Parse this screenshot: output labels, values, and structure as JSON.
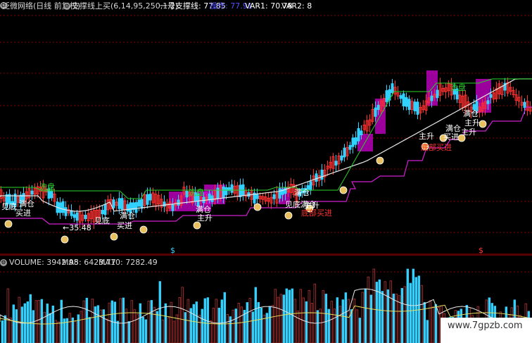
{
  "price_header": {
    "title": "泛微网络(日线 前复权)",
    "indicator": "支撑线上买(6,14,95,250,1,2)",
    "support_label": "一号支撑线: 77.85",
    "op_label": "操作: 77.91",
    "var1_label": "VAR1: 70.78",
    "var2_label": "VAR2: 8"
  },
  "volume_header": {
    "volume_label": "VOLUME: 3942.98",
    "ma5_label": "MA5: 6423.77",
    "ma10_label": "MA10: 7282.49"
  },
  "annotations": [
    "见底",
    "满仓",
    "买进",
    "洗盘",
    "←35.48",
    "见底",
    "满仓",
    "买进",
    "洗盘",
    "满仓",
    "主升",
    "满仓",
    "见底满仓",
    "主升",
    "底部买进",
    "主升",
    "底部买进",
    "满仓",
    "买进",
    "满仓",
    "主升",
    "主升",
    "洗盘",
    "$",
    "$"
  ],
  "watermark": "www.7gpzb.com",
  "colors": {
    "up": "#ff3030",
    "down": "#30d0ff",
    "white_line": "#e8e8e8",
    "green_line": "#27d32a",
    "purple_line": "#d020d0",
    "grid_red": "#8a0000",
    "header_text": "#d8d8d8",
    "magenta_fill": "#d000d0",
    "coin": "#e8c060"
  },
  "chart_data": [
    {
      "type": "line",
      "title": "",
      "series": [
        {
          "name": "一号支撑线",
          "values": [
            60,
            60,
            60,
            62,
            60,
            58,
            58,
            58,
            58,
            58,
            58,
            62,
            62,
            62,
            62,
            62,
            64,
            68,
            74,
            76,
            80,
            84,
            88
          ]
        },
        {
          "name": "洗盘",
          "values": [
            68,
            68,
            67,
            67,
            66,
            66,
            66,
            67,
            68,
            68,
            68,
            68,
            68,
            68,
            68,
            70,
            72,
            78,
            84,
            90,
            92,
            94,
            95
          ]
        }
      ]
    },
    {
      "type": "bar",
      "title": "",
      "ylabel": "VOLUME",
      "series": [
        {
          "name": "VOLUME",
          "values": [
            3942.98
          ]
        }
      ]
    }
  ]
}
